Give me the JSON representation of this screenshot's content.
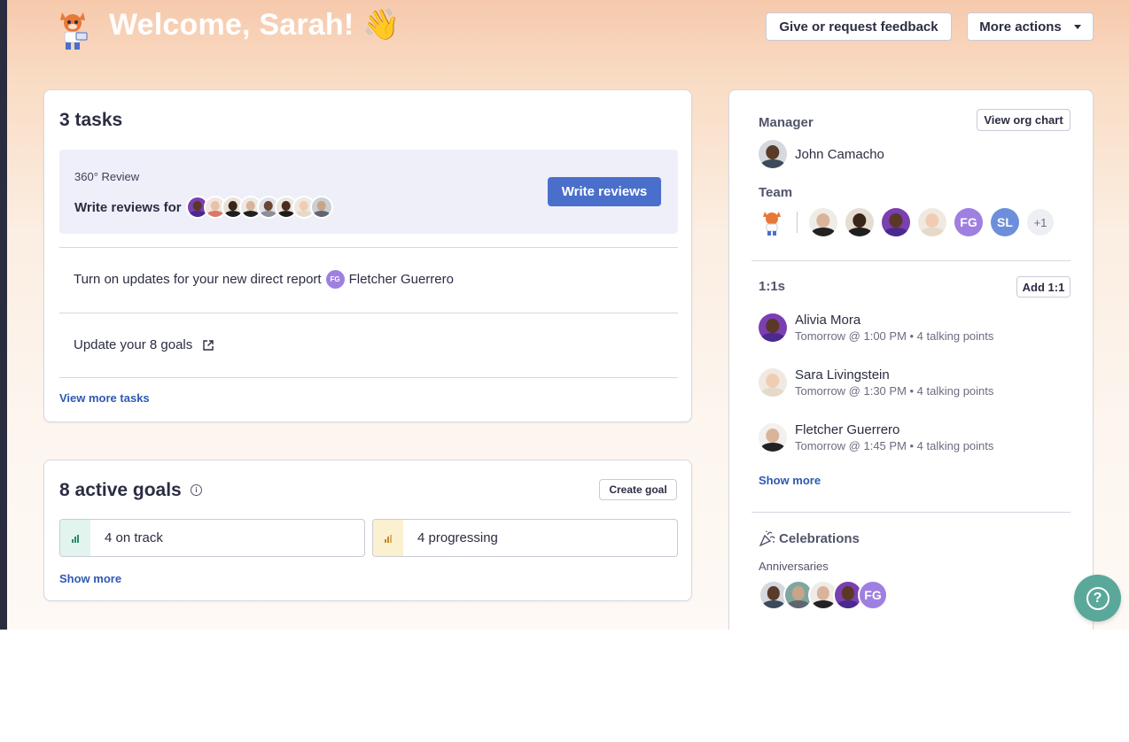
{
  "header": {
    "welcome": "Welcome, Sarah! 👋",
    "feedback_button": "Give or request feedback",
    "more_actions_button": "More actions"
  },
  "tasks": {
    "title": "3 tasks",
    "review": {
      "label": "360° Review",
      "text": "Write reviews for",
      "button": "Write reviews"
    },
    "items": [
      {
        "text": "Turn on updates for your new direct report",
        "badge": "FG",
        "person": "Fletcher Guerrero"
      },
      {
        "text": "Update your 8 goals",
        "icon": "external-link-icon"
      }
    ],
    "view_more": "View more tasks"
  },
  "goals": {
    "title": "8 active goals",
    "info_icon": "i",
    "create_button": "Create goal",
    "boxes": [
      {
        "label": "4 on track",
        "color": "#2e8a6b",
        "bg": "#e2f4ee"
      },
      {
        "label": "4 progressing",
        "color": "#c28a2a",
        "bg": "#fbf0cf"
      }
    ],
    "show_more": "Show more"
  },
  "sidebar": {
    "manager_heading": "Manager",
    "org_chart_button": "View org chart",
    "manager_name": "John Camacho",
    "team_heading": "Team",
    "team_initials": [
      "FG",
      "SL"
    ],
    "team_more": "+1",
    "oneonones_heading": "1:1s",
    "add_button": "Add 1:1",
    "oneonones": [
      {
        "name": "Alivia Mora",
        "meta": "Tomorrow @ 1:00 PM • 4 talking points"
      },
      {
        "name": "Sara Livingstein",
        "meta": "Tomorrow @ 1:30 PM • 4 talking points"
      },
      {
        "name": "Fletcher Guerrero",
        "meta": "Tomorrow @ 1:45 PM • 4 talking points"
      }
    ],
    "show_more": "Show more",
    "celebrations_heading": "Celebrations",
    "anniversaries_label": "Anniversaries",
    "anniv_initials": "FG"
  },
  "help": {
    "icon": "?"
  },
  "colors": {
    "accent": "#4a6fcb",
    "link": "#2f58b3",
    "help": "#5aa89a",
    "fg_purple": "#9f80e0",
    "sl_blue": "#6d8fdb"
  }
}
